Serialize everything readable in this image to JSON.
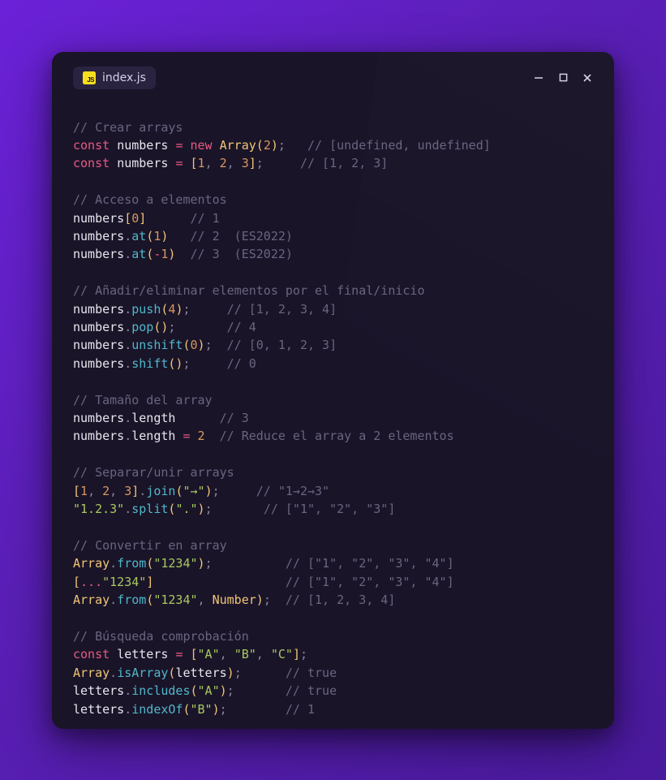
{
  "window": {
    "tab": {
      "filename": "index.js",
      "icon_label": "JS"
    }
  },
  "code": {
    "lines": [
      [
        {
          "t": "comment",
          "v": "// Crear arrays"
        }
      ],
      [
        {
          "t": "keyword",
          "v": "const"
        },
        {
          "t": "any",
          "v": " "
        },
        {
          "t": "var",
          "v": "numbers"
        },
        {
          "t": "any",
          "v": " "
        },
        {
          "t": "op",
          "v": "="
        },
        {
          "t": "any",
          "v": " "
        },
        {
          "t": "new",
          "v": "new"
        },
        {
          "t": "any",
          "v": " "
        },
        {
          "t": "class",
          "v": "Array"
        },
        {
          "t": "bracket",
          "v": "("
        },
        {
          "t": "num",
          "v": "2"
        },
        {
          "t": "bracket",
          "v": ")"
        },
        {
          "t": "punct",
          "v": ";"
        },
        {
          "t": "any",
          "v": "   "
        },
        {
          "t": "comment",
          "v": "// [undefined, undefined]"
        }
      ],
      [
        {
          "t": "keyword",
          "v": "const"
        },
        {
          "t": "any",
          "v": " "
        },
        {
          "t": "var",
          "v": "numbers"
        },
        {
          "t": "any",
          "v": " "
        },
        {
          "t": "op",
          "v": "="
        },
        {
          "t": "any",
          "v": " "
        },
        {
          "t": "bracket",
          "v": "["
        },
        {
          "t": "num",
          "v": "1"
        },
        {
          "t": "punct",
          "v": ", "
        },
        {
          "t": "num",
          "v": "2"
        },
        {
          "t": "punct",
          "v": ", "
        },
        {
          "t": "num",
          "v": "3"
        },
        {
          "t": "bracket",
          "v": "]"
        },
        {
          "t": "punct",
          "v": ";"
        },
        {
          "t": "any",
          "v": "     "
        },
        {
          "t": "comment",
          "v": "// [1, 2, 3]"
        }
      ],
      [],
      [
        {
          "t": "comment",
          "v": "// Acceso a elementos"
        }
      ],
      [
        {
          "t": "var",
          "v": "numbers"
        },
        {
          "t": "bracket",
          "v": "["
        },
        {
          "t": "num",
          "v": "0"
        },
        {
          "t": "bracket",
          "v": "]"
        },
        {
          "t": "any",
          "v": "      "
        },
        {
          "t": "comment",
          "v": "// 1"
        }
      ],
      [
        {
          "t": "var",
          "v": "numbers"
        },
        {
          "t": "punct",
          "v": "."
        },
        {
          "t": "func",
          "v": "at"
        },
        {
          "t": "bracket",
          "v": "("
        },
        {
          "t": "num",
          "v": "1"
        },
        {
          "t": "bracket",
          "v": ")"
        },
        {
          "t": "any",
          "v": "   "
        },
        {
          "t": "comment",
          "v": "// 2  (ES2022)"
        }
      ],
      [
        {
          "t": "var",
          "v": "numbers"
        },
        {
          "t": "punct",
          "v": "."
        },
        {
          "t": "func",
          "v": "at"
        },
        {
          "t": "bracket",
          "v": "("
        },
        {
          "t": "op",
          "v": "-"
        },
        {
          "t": "num",
          "v": "1"
        },
        {
          "t": "bracket",
          "v": ")"
        },
        {
          "t": "any",
          "v": "  "
        },
        {
          "t": "comment",
          "v": "// 3  (ES2022)"
        }
      ],
      [],
      [
        {
          "t": "comment",
          "v": "// Añadir/eliminar elementos por el final/inicio"
        }
      ],
      [
        {
          "t": "var",
          "v": "numbers"
        },
        {
          "t": "punct",
          "v": "."
        },
        {
          "t": "func",
          "v": "push"
        },
        {
          "t": "bracket",
          "v": "("
        },
        {
          "t": "num",
          "v": "4"
        },
        {
          "t": "bracket",
          "v": ")"
        },
        {
          "t": "punct",
          "v": ";"
        },
        {
          "t": "any",
          "v": "     "
        },
        {
          "t": "comment",
          "v": "// [1, 2, 3, 4]"
        }
      ],
      [
        {
          "t": "var",
          "v": "numbers"
        },
        {
          "t": "punct",
          "v": "."
        },
        {
          "t": "func",
          "v": "pop"
        },
        {
          "t": "bracket",
          "v": "()"
        },
        {
          "t": "punct",
          "v": ";"
        },
        {
          "t": "any",
          "v": "       "
        },
        {
          "t": "comment",
          "v": "// 4"
        }
      ],
      [
        {
          "t": "var",
          "v": "numbers"
        },
        {
          "t": "punct",
          "v": "."
        },
        {
          "t": "func",
          "v": "unshift"
        },
        {
          "t": "bracket",
          "v": "("
        },
        {
          "t": "num",
          "v": "0"
        },
        {
          "t": "bracket",
          "v": ")"
        },
        {
          "t": "punct",
          "v": ";"
        },
        {
          "t": "any",
          "v": "  "
        },
        {
          "t": "comment",
          "v": "// [0, 1, 2, 3]"
        }
      ],
      [
        {
          "t": "var",
          "v": "numbers"
        },
        {
          "t": "punct",
          "v": "."
        },
        {
          "t": "func",
          "v": "shift"
        },
        {
          "t": "bracket",
          "v": "()"
        },
        {
          "t": "punct",
          "v": ";"
        },
        {
          "t": "any",
          "v": "     "
        },
        {
          "t": "comment",
          "v": "// 0"
        }
      ],
      [],
      [
        {
          "t": "comment",
          "v": "// Tamaño del array"
        }
      ],
      [
        {
          "t": "var",
          "v": "numbers"
        },
        {
          "t": "punct",
          "v": "."
        },
        {
          "t": "prop",
          "v": "length"
        },
        {
          "t": "any",
          "v": "      "
        },
        {
          "t": "comment",
          "v": "// 3"
        }
      ],
      [
        {
          "t": "var",
          "v": "numbers"
        },
        {
          "t": "punct",
          "v": "."
        },
        {
          "t": "prop",
          "v": "length"
        },
        {
          "t": "any",
          "v": " "
        },
        {
          "t": "op",
          "v": "="
        },
        {
          "t": "any",
          "v": " "
        },
        {
          "t": "num",
          "v": "2"
        },
        {
          "t": "any",
          "v": "  "
        },
        {
          "t": "comment",
          "v": "// Reduce el array a 2 elementos"
        }
      ],
      [],
      [
        {
          "t": "comment",
          "v": "// Separar/unir arrays"
        }
      ],
      [
        {
          "t": "bracket",
          "v": "["
        },
        {
          "t": "num",
          "v": "1"
        },
        {
          "t": "punct",
          "v": ", "
        },
        {
          "t": "num",
          "v": "2"
        },
        {
          "t": "punct",
          "v": ", "
        },
        {
          "t": "num",
          "v": "3"
        },
        {
          "t": "bracket",
          "v": "]"
        },
        {
          "t": "punct",
          "v": "."
        },
        {
          "t": "func",
          "v": "join"
        },
        {
          "t": "bracket",
          "v": "("
        },
        {
          "t": "str",
          "v": "\"→\""
        },
        {
          "t": "bracket",
          "v": ")"
        },
        {
          "t": "punct",
          "v": ";"
        },
        {
          "t": "any",
          "v": "     "
        },
        {
          "t": "comment",
          "v": "// \"1→2→3\""
        }
      ],
      [
        {
          "t": "str",
          "v": "\"1.2.3\""
        },
        {
          "t": "punct",
          "v": "."
        },
        {
          "t": "func",
          "v": "split"
        },
        {
          "t": "bracket",
          "v": "("
        },
        {
          "t": "str",
          "v": "\".\""
        },
        {
          "t": "bracket",
          "v": ")"
        },
        {
          "t": "punct",
          "v": ";"
        },
        {
          "t": "any",
          "v": "       "
        },
        {
          "t": "comment",
          "v": "// [\"1\", \"2\", \"3\"]"
        }
      ],
      [],
      [
        {
          "t": "comment",
          "v": "// Convertir en array"
        }
      ],
      [
        {
          "t": "class",
          "v": "Array"
        },
        {
          "t": "punct",
          "v": "."
        },
        {
          "t": "func",
          "v": "from"
        },
        {
          "t": "bracket",
          "v": "("
        },
        {
          "t": "str",
          "v": "\"1234\""
        },
        {
          "t": "bracket",
          "v": ")"
        },
        {
          "t": "punct",
          "v": ";"
        },
        {
          "t": "any",
          "v": "          "
        },
        {
          "t": "comment",
          "v": "// [\"1\", \"2\", \"3\", \"4\"]"
        }
      ],
      [
        {
          "t": "bracket",
          "v": "["
        },
        {
          "t": "op",
          "v": "..."
        },
        {
          "t": "str",
          "v": "\"1234\""
        },
        {
          "t": "bracket",
          "v": "]"
        },
        {
          "t": "any",
          "v": "                  "
        },
        {
          "t": "comment",
          "v": "// [\"1\", \"2\", \"3\", \"4\"]"
        }
      ],
      [
        {
          "t": "class",
          "v": "Array"
        },
        {
          "t": "punct",
          "v": "."
        },
        {
          "t": "func",
          "v": "from"
        },
        {
          "t": "bracket",
          "v": "("
        },
        {
          "t": "str",
          "v": "\"1234\""
        },
        {
          "t": "punct",
          "v": ", "
        },
        {
          "t": "class",
          "v": "Number"
        },
        {
          "t": "bracket",
          "v": ")"
        },
        {
          "t": "punct",
          "v": ";"
        },
        {
          "t": "any",
          "v": "  "
        },
        {
          "t": "comment",
          "v": "// [1, 2, 3, 4]"
        }
      ],
      [],
      [
        {
          "t": "comment",
          "v": "// Búsqueda comprobación"
        }
      ],
      [
        {
          "t": "keyword",
          "v": "const"
        },
        {
          "t": "any",
          "v": " "
        },
        {
          "t": "var",
          "v": "letters"
        },
        {
          "t": "any",
          "v": " "
        },
        {
          "t": "op",
          "v": "="
        },
        {
          "t": "any",
          "v": " "
        },
        {
          "t": "bracket",
          "v": "["
        },
        {
          "t": "str",
          "v": "\"A\""
        },
        {
          "t": "punct",
          "v": ", "
        },
        {
          "t": "str",
          "v": "\"B\""
        },
        {
          "t": "punct",
          "v": ", "
        },
        {
          "t": "str",
          "v": "\"C\""
        },
        {
          "t": "bracket",
          "v": "]"
        },
        {
          "t": "punct",
          "v": ";"
        }
      ],
      [
        {
          "t": "class",
          "v": "Array"
        },
        {
          "t": "punct",
          "v": "."
        },
        {
          "t": "func",
          "v": "isArray"
        },
        {
          "t": "bracket",
          "v": "("
        },
        {
          "t": "var",
          "v": "letters"
        },
        {
          "t": "bracket",
          "v": ")"
        },
        {
          "t": "punct",
          "v": ";"
        },
        {
          "t": "any",
          "v": "      "
        },
        {
          "t": "comment",
          "v": "// true"
        }
      ],
      [
        {
          "t": "var",
          "v": "letters"
        },
        {
          "t": "punct",
          "v": "."
        },
        {
          "t": "func",
          "v": "includes"
        },
        {
          "t": "bracket",
          "v": "("
        },
        {
          "t": "str",
          "v": "\"A\""
        },
        {
          "t": "bracket",
          "v": ")"
        },
        {
          "t": "punct",
          "v": ";"
        },
        {
          "t": "any",
          "v": "       "
        },
        {
          "t": "comment",
          "v": "// true"
        }
      ],
      [
        {
          "t": "var",
          "v": "letters"
        },
        {
          "t": "punct",
          "v": "."
        },
        {
          "t": "func",
          "v": "indexOf"
        },
        {
          "t": "bracket",
          "v": "("
        },
        {
          "t": "str",
          "v": "\"B\""
        },
        {
          "t": "bracket",
          "v": ")"
        },
        {
          "t": "punct",
          "v": ";"
        },
        {
          "t": "any",
          "v": "        "
        },
        {
          "t": "comment",
          "v": "// 1"
        }
      ]
    ]
  }
}
